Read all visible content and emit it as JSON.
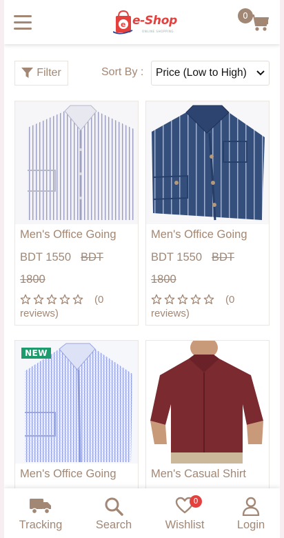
{
  "header": {
    "brand": "e-Shop",
    "tagline": "ONLINE SHOPPING",
    "cart_count": "0"
  },
  "toolbar": {
    "filter_label": "Filter",
    "sort_label": "Sort By :",
    "sort_value": "Price (Low to High)"
  },
  "products": [
    {
      "name": "Men's Office Going",
      "price": "BDT 1550",
      "old_price_a": "BDT",
      "old_price_b": "1800",
      "reviews_a": "(0",
      "reviews_b": "reviews)",
      "image": "white-blue-striped-shirt",
      "rating": 0
    },
    {
      "name": "Men's Office Going",
      "price": "BDT 1550",
      "old_price_a": "BDT",
      "old_price_b": "1800",
      "reviews_a": "(0",
      "reviews_b": "reviews)",
      "image": "navy-striped-shirt",
      "rating": 0
    },
    {
      "name": "Men's Office Going",
      "badge": "NEW",
      "image": "light-blue-check-shirt"
    },
    {
      "name": "Men's Casual Shirt",
      "image": "maroon-casual-shirt"
    }
  ],
  "bottom_nav": {
    "tracking": "Tracking",
    "search": "Search",
    "wishlist": "Wishlist",
    "wishlist_count": "0",
    "login": "Login"
  },
  "colors": {
    "accent": "#a28774",
    "brand_red": "#e4403d",
    "badge_green": "#1d9b6c"
  }
}
